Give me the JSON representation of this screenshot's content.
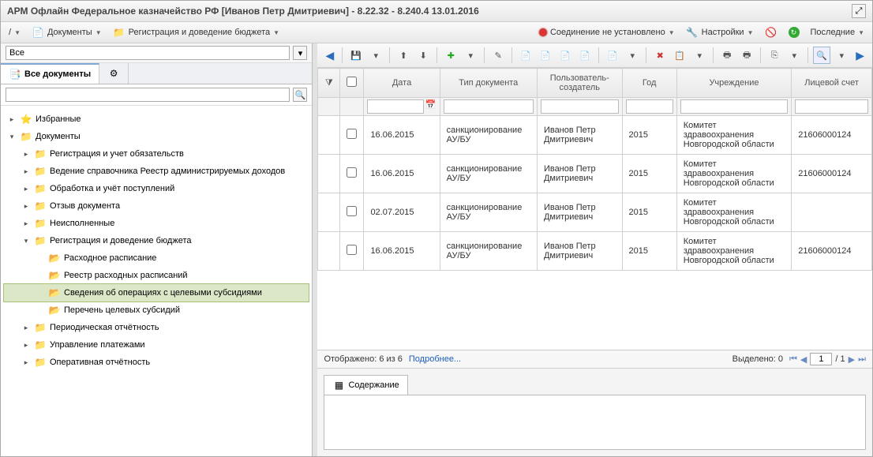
{
  "window": {
    "title": "АРМ Офлайн Федеральное казначейство РФ [Иванов Петр Дмитриевич] - 8.22.32 - 8.240.4 13.01.2016"
  },
  "menubar": {
    "documents": "Документы",
    "registration": "Регистрация и доведение бюджета",
    "connection": "Соединение не установлено",
    "settings": "Настройки",
    "recent": "Последние"
  },
  "sidebar": {
    "search_placeholder": "Все",
    "tab_all": "Все документы",
    "tree": {
      "fav": "Избранные",
      "docs": "Документы",
      "n1": "Регистрация и учет обязательств",
      "n2": "Ведение справочника Реестр администрируемых доходов",
      "n3": "Обработка и учёт поступлений",
      "n4": "Отзыв документа",
      "n5": "Неисполненные",
      "n6": "Регистрация и доведение бюджета",
      "c1": "Расходное расписание",
      "c2": "Реестр расходных расписаний",
      "c3": "Сведения об операциях с целевыми субсидиями",
      "c4": "Перечень целевых субсидий",
      "n7": "Периодическая отчётность",
      "n8": "Управление платежами",
      "n9": "Оперативная отчётность"
    }
  },
  "grid": {
    "cols": {
      "date": "Дата",
      "doctype": "Тип документа",
      "creator": "Пользователь-создатель",
      "year": "Год",
      "org": "Учреждение",
      "acc": "Лицевой счет"
    },
    "rows": [
      {
        "date": "16.06.2015",
        "doctype": "санкционирование АУ/БУ",
        "creator": "Иванов Петр Дмитриевич",
        "year": "2015",
        "org": "Комитет здравоохранения Новгородской области",
        "acc": "21606000124"
      },
      {
        "date": "16.06.2015",
        "doctype": "санкционирование АУ/БУ",
        "creator": "Иванов Петр Дмитриевич",
        "year": "2015",
        "org": "Комитет здравоохранения Новгородской области",
        "acc": "21606000124"
      },
      {
        "date": "02.07.2015",
        "doctype": "санкционирование АУ/БУ",
        "creator": "Иванов Петр Дмитриевич",
        "year": "2015",
        "org": "Комитет здравоохранения Новгородской области",
        "acc": ""
      },
      {
        "date": "16.06.2015",
        "doctype": "санкционирование АУ/БУ",
        "creator": "Иванов Петр Дмитриевич",
        "year": "2015",
        "org": "Комитет здравоохранения Новгородской области",
        "acc": "21606000124"
      }
    ]
  },
  "status": {
    "shown": "Отображено: 6 из 6",
    "more": "Подробнее...",
    "selected": "Выделено: 0",
    "page": "1",
    "of": "/ 1"
  },
  "detail": {
    "tab": "Содержание"
  }
}
